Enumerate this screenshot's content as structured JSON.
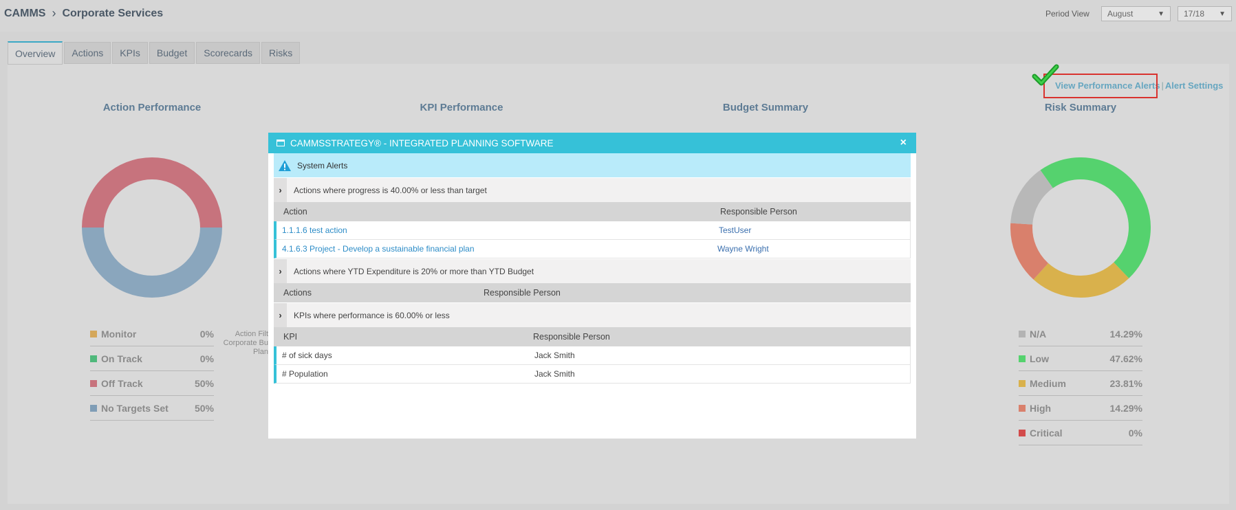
{
  "breadcrumb": {
    "root": "CAMMS",
    "current": "Corporate Services"
  },
  "period": {
    "label": "Period View",
    "month": "August",
    "year": "17/18"
  },
  "tabs": [
    "Overview",
    "Actions",
    "KPIs",
    "Budget",
    "Scorecards",
    "Risks"
  ],
  "active_tab": "Overview",
  "alert_links": {
    "view": "View Performance Alerts",
    "separator": "|",
    "settings": "Alert Settings"
  },
  "sections": {
    "action": "Action Performance",
    "kpi": "KPI Performance",
    "budget": "Budget Summary",
    "risk": "Risk Summary"
  },
  "action_filter": [
    "Action Filt",
    "Corporate Bu",
    "Plan"
  ],
  "action_legend": [
    {
      "label": "Monitor",
      "value": "0%",
      "color": "#d4a75a"
    },
    {
      "label": "On Track",
      "value": "0%",
      "color": "#4fb87b"
    },
    {
      "label": "Off Track",
      "value": "50%",
      "color": "#c7737d"
    },
    {
      "label": "No Targets Set",
      "value": "50%",
      "color": "#7f9db6"
    }
  ],
  "action_donut": [
    {
      "label": "Off Track",
      "fraction": 0.5,
      "color": "#c7737d"
    },
    {
      "label": "No Targets Set",
      "fraction": 0.5,
      "color": "#8aa6bd"
    }
  ],
  "risk_legend": [
    {
      "label": "N/A",
      "value": "14.29%",
      "color": "#b3b3b3"
    },
    {
      "label": "Low",
      "value": "47.62%",
      "color": "#55d26e"
    },
    {
      "label": "Medium",
      "value": "23.81%",
      "color": "#d9b14c"
    },
    {
      "label": "High",
      "value": "14.29%",
      "color": "#d9806c"
    },
    {
      "label": "Critical",
      "value": "0%",
      "color": "#d24b4b"
    }
  ],
  "risk_donut": [
    {
      "label": "Low",
      "fraction": 0.4762,
      "color": "#55d26e"
    },
    {
      "label": "Medium",
      "fraction": 0.2381,
      "color": "#d9b14c"
    },
    {
      "label": "High",
      "fraction": 0.1429,
      "color": "#d9806c"
    },
    {
      "label": "N/A",
      "fraction": 0.1429,
      "color": "#b8b8b8"
    }
  ],
  "modal": {
    "title": "CAMMSSTRATEGY® - INTEGRATED PLANNING SOFTWARE",
    "close": "×",
    "system_alerts": "System Alerts",
    "groups": [
      {
        "title": "Actions where progress is 40.00% or less than target",
        "col1": "Action",
        "col2": "Responsible Person",
        "rows": [
          {
            "item": "1.1.1.6 test action",
            "person": "TestUser"
          },
          {
            "item": "4.1.6.3 Project - Develop a sustainable financial plan",
            "person": "Wayne Wright"
          }
        ]
      },
      {
        "title": "Actions where YTD Expenditure is 20% or more than YTD Budget",
        "col1": "Actions",
        "col2": "Responsible Person",
        "rows": []
      },
      {
        "title": "KPIs where performance is 60.00% or less",
        "col1": "KPI",
        "col2": "Responsible Person",
        "rows": [
          {
            "item": "# of sick days",
            "person": "Jack Smith"
          },
          {
            "item": "# Population",
            "person": "Jack Smith"
          }
        ]
      }
    ]
  }
}
